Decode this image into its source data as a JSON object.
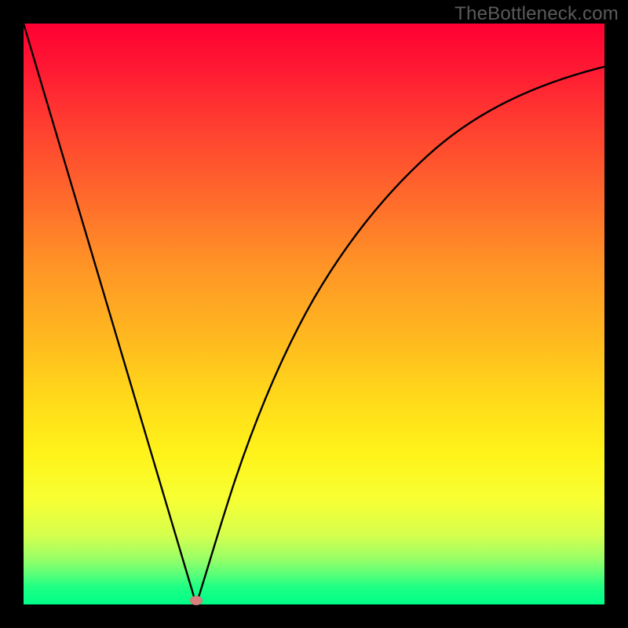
{
  "watermark": "TheBottleneck.com",
  "chart_data": {
    "type": "line",
    "title": "",
    "xlabel": "",
    "ylabel": "",
    "xlim": [
      0,
      1
    ],
    "ylim": [
      0,
      1
    ],
    "background": "red-to-green vertical gradient",
    "series": [
      {
        "name": "bottleneck-curve",
        "x": [
          0.0,
          0.05,
          0.1,
          0.15,
          0.2,
          0.25,
          0.2973,
          0.35,
          0.4,
          0.45,
          0.5,
          0.55,
          0.6,
          0.65,
          0.7,
          0.75,
          0.8,
          0.85,
          0.9,
          0.95,
          1.0
        ],
        "y": [
          1.0,
          0.832,
          0.664,
          0.495,
          0.327,
          0.159,
          0.0,
          0.17,
          0.306,
          0.417,
          0.508,
          0.584,
          0.648,
          0.702,
          0.748,
          0.787,
          0.82,
          0.847,
          0.87,
          0.889,
          0.905
        ]
      }
    ],
    "marker": {
      "x": 0.2973,
      "y": 0.0
    },
    "colors": {
      "curve": "#000000",
      "marker": "#d98080",
      "gradient_top": "#ff0033",
      "gradient_bottom": "#00ff88"
    }
  }
}
